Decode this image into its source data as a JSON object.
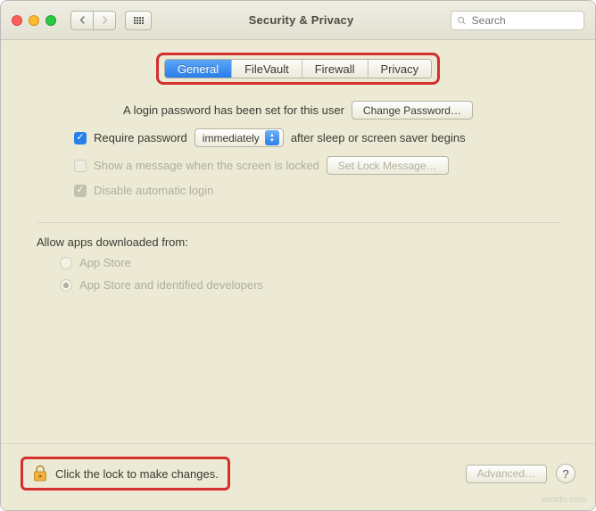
{
  "window": {
    "title": "Security & Privacy"
  },
  "search": {
    "placeholder": "Search"
  },
  "tabs": [
    "General",
    "FileVault",
    "Firewall",
    "Privacy"
  ],
  "general": {
    "login_password_msg": "A login password has been set for this user",
    "change_password_btn": "Change Password…",
    "require_password_label": "Require password",
    "require_password_select": "immediately",
    "require_password_suffix": "after sleep or screen saver begins",
    "show_message_label": "Show a message when the screen is locked",
    "set_lock_msg_btn": "Set Lock Message…",
    "disable_auto_login_label": "Disable automatic login",
    "allow_apps_heading": "Allow apps downloaded from:",
    "allow_option_1": "App Store",
    "allow_option_2": "App Store and identified developers"
  },
  "footer": {
    "lock_msg": "Click the lock to make changes.",
    "advanced_btn": "Advanced…",
    "help": "?"
  },
  "watermark": "wsxdn.com"
}
